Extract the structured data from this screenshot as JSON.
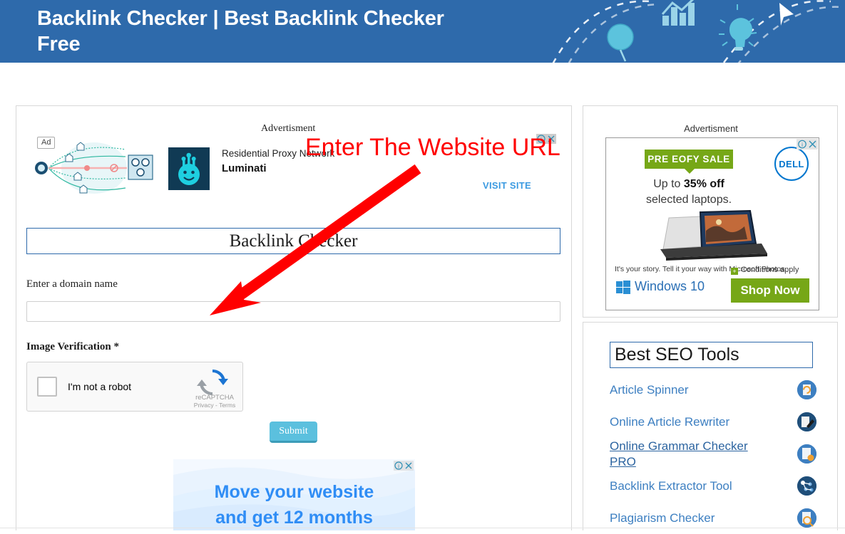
{
  "header": {
    "title": "Backlink Checker | Best Backlink Checker Free",
    "icons": [
      "balloon-icon",
      "bar-chart-growth-icon",
      "lightbulb-icon",
      "cursor-triangle-icon"
    ],
    "bg_color": "#2e6aab"
  },
  "annotation": {
    "text": "Enter The Website URL",
    "color": "#ff0000",
    "arrow": "red-arrow-pointing-to-domain-input"
  },
  "top_ad": {
    "label": "Advertisment",
    "badge": "Ad",
    "line1": "Residential Proxy Network",
    "line2": "Luminati",
    "cta": "VISIT SITE",
    "controls": [
      "info-icon",
      "close-icon"
    ]
  },
  "form": {
    "title": "Backlink Checker",
    "domain_label": "Enter a domain name",
    "domain_value": "",
    "domain_placeholder": "",
    "verification_label": "Image Verification *",
    "captcha": {
      "checkbox_label": "I'm not a robot",
      "brand": "reCAPTCHA",
      "privacy": "Privacy - Terms",
      "checked": false
    },
    "submit_label": "Submit",
    "submit_color": "#5bc0de"
  },
  "bottom_ad": {
    "line1": "Move your website",
    "line2": "and get 12 months",
    "controls": [
      "info-icon",
      "close-icon"
    ]
  },
  "sidebar": {
    "ad_label": "Advertisment",
    "dell_ad": {
      "badge": "PRE EOFY SALE",
      "offer_pre": "Up to ",
      "offer_strong": "35% off",
      "offer_post": "selected laptops.",
      "brand": "DELL",
      "story": "It's your story. Tell it your way with Microsoft Photos.",
      "windows": "Windows 10",
      "conditions": "Conditions apply",
      "cta": "Shop Now",
      "badge_color": "#76a717",
      "brand_color": "#0076ce",
      "controls": [
        "info-icon",
        "close-icon"
      ]
    },
    "tools_title": "Best SEO Tools",
    "tools": [
      {
        "label": "Article Spinner",
        "icon": "article-spinner-icon",
        "hovered": false
      },
      {
        "label": "Online Article Rewriter",
        "icon": "article-rewriter-icon",
        "hovered": false
      },
      {
        "label": "Online Grammar Checker PRO",
        "icon": "grammar-checker-icon",
        "hovered": true
      },
      {
        "label": "Backlink Extractor Tool",
        "icon": "backlink-extractor-icon",
        "hovered": false
      },
      {
        "label": "Plagiarism Checker",
        "icon": "plagiarism-checker-icon",
        "hovered": false
      }
    ]
  }
}
